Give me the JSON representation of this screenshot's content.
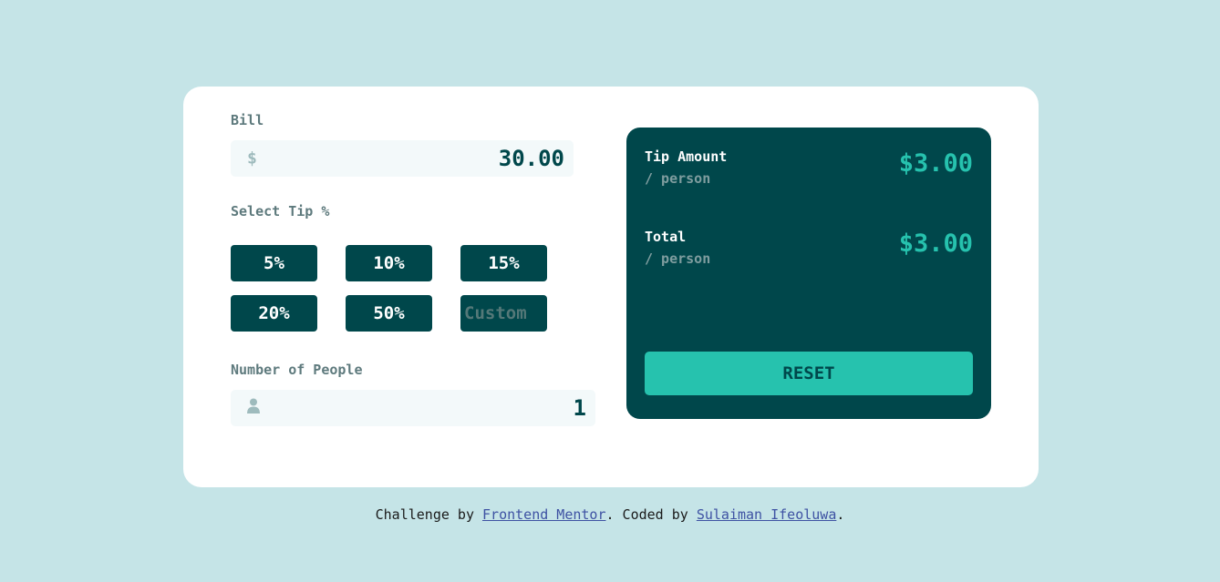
{
  "form": {
    "bill_label": "Bill",
    "bill_currency": "$",
    "bill_value": "30.00",
    "tip_label": "Select Tip %",
    "tip_options": [
      "5%",
      "10%",
      "15%",
      "20%",
      "50%"
    ],
    "custom_placeholder": "Custom",
    "people_label": "Number of People",
    "people_value": "1",
    "people_icon": "person-icon"
  },
  "results": {
    "tip_title": "Tip Amount",
    "tip_sub": "/ person",
    "tip_value": "$3.00",
    "total_title": "Total",
    "total_sub": "/ person",
    "total_value": "$3.00",
    "reset_label": "RESET"
  },
  "footer": {
    "prefix": "Challenge by ",
    "link1": "Frontend Mentor",
    "middle": ". Coded by ",
    "link2": "Sulaiman Ifeoluwa",
    "suffix": "."
  },
  "colors": {
    "background": "#c5e4e7",
    "dark_cyan": "#00474b",
    "strong_cyan": "#26c2ae",
    "input_bg": "#f3f9fa"
  }
}
